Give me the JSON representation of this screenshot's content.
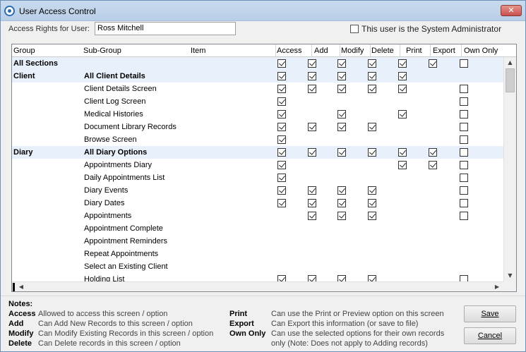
{
  "window": {
    "title": "User Access Control",
    "close_glyph": "✕"
  },
  "user": {
    "label": "Access Rights for User:",
    "value": "Ross Mitchell"
  },
  "sysadmin": {
    "label": "This user is the System Administrator",
    "checked": false
  },
  "columns": [
    "Group",
    "Sub-Group",
    "Item",
    "Access",
    "Add",
    "Modify",
    "Delete",
    "Print",
    "Export",
    "Own Only"
  ],
  "rows": [
    {
      "group": "All Sections",
      "subgroup": "",
      "bold": true,
      "shaded": true,
      "checks": [
        true,
        true,
        true,
        true,
        true,
        true,
        false
      ]
    },
    {
      "group": "Client",
      "subgroup": "All Client Details",
      "bold": true,
      "shaded": true,
      "checks": [
        true,
        true,
        true,
        true,
        true,
        null,
        null
      ]
    },
    {
      "group": "",
      "subgroup": "Client Details Screen",
      "bold": false,
      "shaded": false,
      "checks": [
        true,
        true,
        true,
        true,
        true,
        null,
        false
      ]
    },
    {
      "group": "",
      "subgroup": "Client Log Screen",
      "bold": false,
      "shaded": false,
      "checks": [
        true,
        null,
        null,
        null,
        null,
        null,
        false
      ]
    },
    {
      "group": "",
      "subgroup": "Medical Histories",
      "bold": false,
      "shaded": false,
      "checks": [
        true,
        null,
        true,
        null,
        true,
        null,
        false
      ]
    },
    {
      "group": "",
      "subgroup": "Document Library Records",
      "bold": false,
      "shaded": false,
      "checks": [
        true,
        true,
        true,
        true,
        null,
        null,
        false
      ]
    },
    {
      "group": "",
      "subgroup": "Browse Screen",
      "bold": false,
      "shaded": false,
      "checks": [
        true,
        null,
        null,
        null,
        null,
        null,
        false
      ]
    },
    {
      "group": "Diary",
      "subgroup": "All Diary Options",
      "bold": true,
      "shaded": true,
      "checks": [
        true,
        true,
        true,
        true,
        true,
        true,
        false
      ]
    },
    {
      "group": "",
      "subgroup": "Appointments Diary",
      "bold": false,
      "shaded": false,
      "checks": [
        true,
        null,
        null,
        null,
        true,
        true,
        false
      ]
    },
    {
      "group": "",
      "subgroup": "Daily Appointments List",
      "bold": false,
      "shaded": false,
      "checks": [
        true,
        null,
        null,
        null,
        null,
        null,
        false
      ]
    },
    {
      "group": "",
      "subgroup": "Diary Events",
      "bold": false,
      "shaded": false,
      "checks": [
        true,
        true,
        true,
        true,
        null,
        null,
        false
      ]
    },
    {
      "group": "",
      "subgroup": "Diary Dates",
      "bold": false,
      "shaded": false,
      "checks": [
        true,
        true,
        true,
        true,
        null,
        null,
        false
      ]
    },
    {
      "group": "",
      "subgroup": "Appointments",
      "bold": false,
      "shaded": false,
      "checks": [
        null,
        true,
        true,
        true,
        null,
        null,
        false
      ]
    },
    {
      "group": "",
      "subgroup": "Appointment Complete",
      "bold": false,
      "shaded": false,
      "checks": [
        null,
        null,
        null,
        null,
        null,
        null,
        null
      ]
    },
    {
      "group": "",
      "subgroup": "Appointment Reminders",
      "bold": false,
      "shaded": false,
      "checks": [
        null,
        null,
        null,
        null,
        null,
        null,
        null
      ]
    },
    {
      "group": "",
      "subgroup": "Repeat Appointments",
      "bold": false,
      "shaded": false,
      "checks": [
        null,
        null,
        null,
        null,
        null,
        null,
        null
      ]
    },
    {
      "group": "",
      "subgroup": "Select an Existing Client",
      "bold": false,
      "shaded": false,
      "checks": [
        null,
        null,
        null,
        null,
        null,
        null,
        null
      ]
    },
    {
      "group": "",
      "subgroup": "Holding List",
      "bold": false,
      "shaded": false,
      "checks": [
        true,
        true,
        true,
        true,
        null,
        null,
        false
      ]
    }
  ],
  "scroll": {
    "up": "▲",
    "down": "▼",
    "left": "◀",
    "right": "▶"
  },
  "notes": {
    "title": "Notes:",
    "left": [
      {
        "key": "Access",
        "text": "Allowed to access this screen / option"
      },
      {
        "key": "Add",
        "text": "Can Add New Records to this screen / option"
      },
      {
        "key": "Modify",
        "text": "Can Modify Existing Records in this screen / option"
      },
      {
        "key": "Delete",
        "text": "Can Delete records in this screen / option"
      }
    ],
    "right": [
      {
        "key": "Print",
        "text": "Can use the Print or Preview option on this screen"
      },
      {
        "key": "Export",
        "text": "Can Export this information (or save to file)"
      },
      {
        "key": "Own Only",
        "text": "Can use the selected options for their own records"
      }
    ],
    "own_only_extra": "only (Note: Does not apply to Adding records)"
  },
  "buttons": {
    "save": "Save",
    "cancel": "Cancel"
  }
}
